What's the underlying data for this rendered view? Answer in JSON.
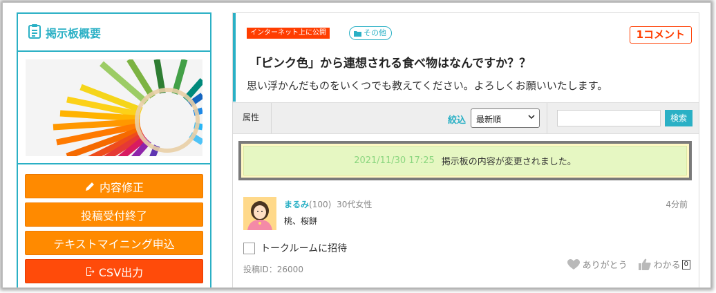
{
  "sidebar": {
    "title": "掲示板概要",
    "title_icon": "clipboard-icon",
    "buttons": [
      {
        "label": "内容修正",
        "icon": "pencil-icon"
      },
      {
        "label": "投稿受付終了"
      },
      {
        "label": "テキストマイニング申込"
      },
      {
        "label": "CSV出力",
        "icon": "export-icon"
      }
    ]
  },
  "post": {
    "visibility_tag": "インターネット上に公開",
    "category": "その他",
    "category_icon": "folder-icon",
    "comment_count": "1コメント",
    "title": "「ピンク色」から連想される食べ物はなんですか？？",
    "description": "思い浮かんだものをいくつでも教えてください。よろしくお願いいたします。"
  },
  "filters": {
    "attribute_label": "属性",
    "narrow_label": "絞込",
    "sort_value": "最新順",
    "search_button": "検索"
  },
  "notice": {
    "timestamp": "2021/11/30 17:25",
    "message": "掲示板の内容が変更されました。"
  },
  "comment": {
    "name": "まるみ",
    "points": "(100)",
    "profile": "30代女性",
    "time": "4分前",
    "body": "桃、桜餅",
    "invite_label": "トークルームに招待",
    "post_id": "投稿ID：26000",
    "thanks_label": "ありがとう",
    "agree_label": "わかる",
    "agree_count": "0"
  },
  "colors": {
    "accent": "#2ab0c5",
    "orange": "#ff8a00",
    "red": "#ff4b0a",
    "notice_bg": "#e6f7c2"
  }
}
